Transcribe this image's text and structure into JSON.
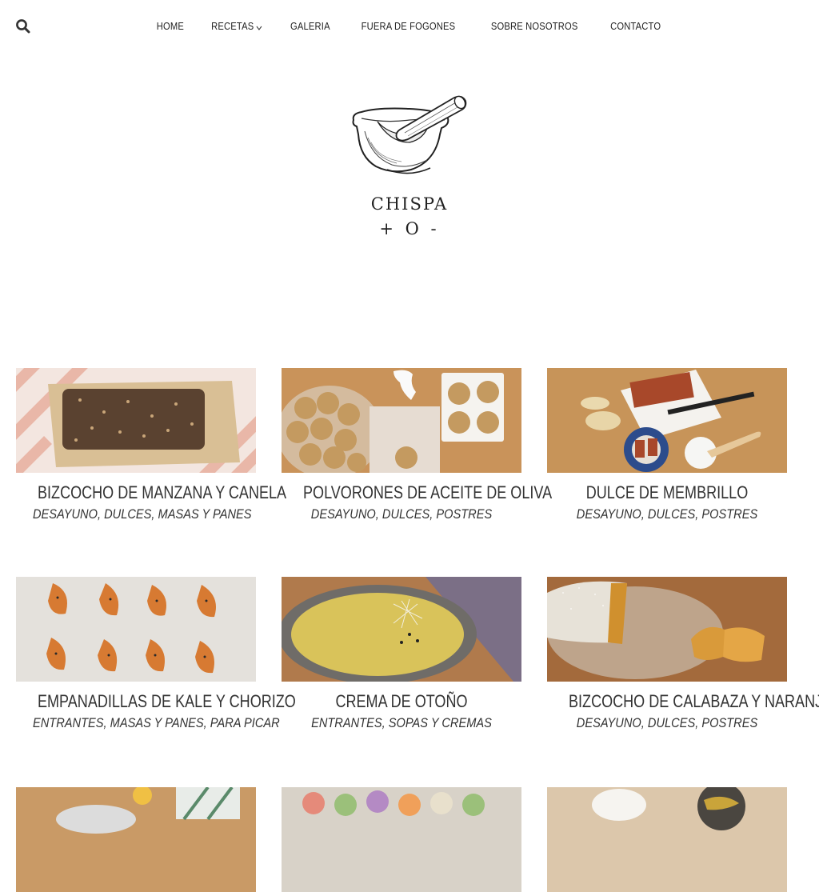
{
  "nav": {
    "search_icon": "search-icon",
    "items": [
      {
        "label": "HOME"
      },
      {
        "label": "RECETAS",
        "has_dropdown": true
      },
      {
        "label": "GALERIA"
      },
      {
        "label": "FUERA DE FOGONES"
      },
      {
        "label": "SOBRE NOSOTROS"
      },
      {
        "label": "CONTACTO"
      }
    ]
  },
  "site": {
    "logo_icon": "mortar-and-pestle-icon",
    "title": "CHISPA",
    "tagline": "+ O -"
  },
  "posts": [
    {
      "title": "BIZCOCHO DE MANZANA Y CANELA",
      "categories": "DESAYUNO, DULCES, MASAS Y PANES"
    },
    {
      "title": "POLVORONES DE ACEITE DE OLIVA",
      "categories": "DESAYUNO, DULCES, POSTRES"
    },
    {
      "title": "DULCE DE MEMBRILLO",
      "categories": "DESAYUNO, DULCES, POSTRES"
    },
    {
      "title": "EMPANADILLAS DE KALE Y CHORIZO",
      "categories": "ENTRANTES, MASAS Y PANES, PARA PICAR"
    },
    {
      "title": "CREMA DE OTOÑO",
      "categories": "ENTRANTES, SOPAS Y CREMAS"
    },
    {
      "title": "BIZCOCHO DE CALABAZA Y NARANJA",
      "categories": "DESAYUNO, DULCES, POSTRES"
    }
  ]
}
